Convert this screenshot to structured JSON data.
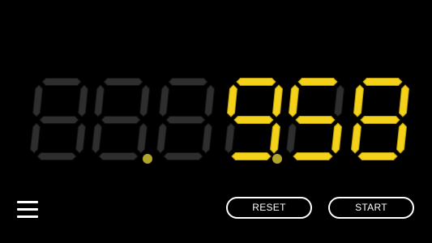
{
  "stopwatch": {
    "digits": [
      "8",
      "8",
      "8",
      "9",
      "5",
      "8"
    ],
    "lit": [
      false,
      false,
      false,
      true,
      true,
      true
    ],
    "separators_after": [
      2,
      4
    ],
    "separator_lit": [
      false,
      true
    ]
  },
  "controls": {
    "menu_icon": "hamburger-icon",
    "reset_label": "RESET",
    "start_label": "START"
  },
  "colors": {
    "background": "#000000",
    "lit_segment": "#f5d21a",
    "lit_segment_edge": "#b89a08",
    "dim_segment": "#2e2e2e",
    "dim_segment_edge": "#111111",
    "separator_dim": "#b2a52c",
    "separator_lit": "#b2a52c",
    "button_border": "#ffffff",
    "button_text": "#ffffff"
  }
}
